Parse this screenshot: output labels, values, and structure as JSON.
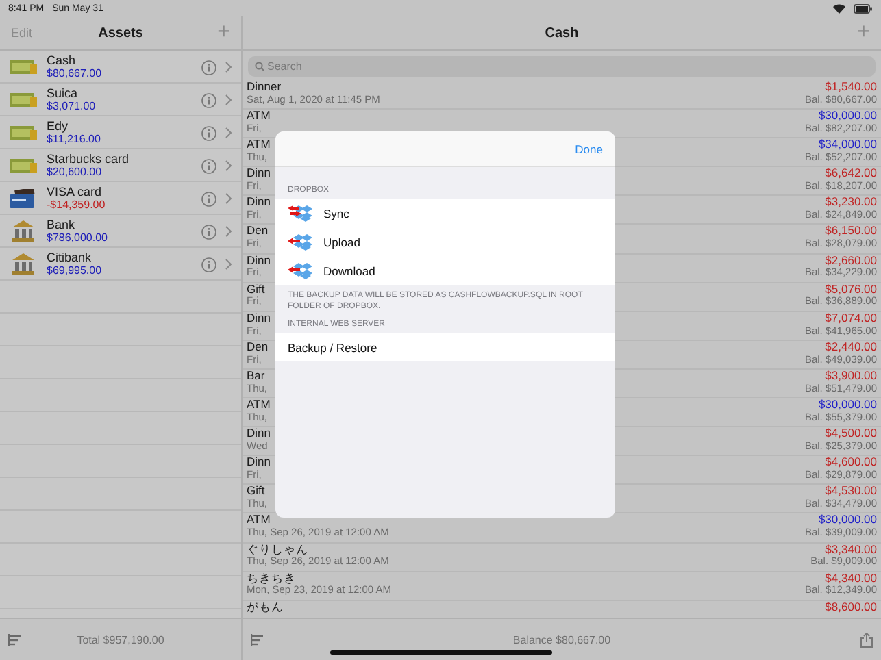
{
  "status_bar": {
    "time": "8:41 PM",
    "date": "Sun May 31"
  },
  "assets": {
    "edit": {
      "label": "Edit",
      "disabled": true
    },
    "title": "Assets",
    "add": "+",
    "items": [
      {
        "name": "Cash",
        "amount": "$80,667.00",
        "kind": "cash",
        "negative": false
      },
      {
        "name": "Suica",
        "amount": "$3,071.00",
        "kind": "cash",
        "negative": false
      },
      {
        "name": "Edy",
        "amount": "$11,216.00",
        "kind": "cash",
        "negative": false
      },
      {
        "name": "Starbucks card",
        "amount": "$20,600.00",
        "kind": "cash",
        "negative": false
      },
      {
        "name": "VISA card",
        "amount": "-$14,359.00",
        "kind": "card",
        "negative": true
      },
      {
        "name": "Bank",
        "amount": "$786,000.00",
        "kind": "bank",
        "negative": false
      },
      {
        "name": "Citibank",
        "amount": "$69,995.00",
        "kind": "bank",
        "negative": false
      }
    ],
    "total": "Total $957,190.00"
  },
  "account": {
    "title": "Cash",
    "add": "+",
    "search": {
      "placeholder": "Search"
    },
    "transactions": [
      {
        "title": "Dinner",
        "date": "Sat, Aug 1, 2020 at 11:45 PM",
        "amount": "$1,540.00",
        "kind": "expense",
        "balance": "Bal. $80,667.00"
      },
      {
        "title": "ATM",
        "date": "Fri,",
        "amount": "$30,000.00",
        "kind": "income",
        "balance": "Bal. $82,207.00"
      },
      {
        "title": "ATM",
        "date": "Thu,",
        "amount": "$34,000.00",
        "kind": "income",
        "balance": "Bal. $52,207.00"
      },
      {
        "title": "Dinn",
        "date": "Fri,",
        "amount": "$6,642.00",
        "kind": "expense",
        "balance": "Bal. $18,207.00"
      },
      {
        "title": "Dinn",
        "date": "Fri,",
        "amount": "$3,230.00",
        "kind": "expense",
        "balance": "Bal. $24,849.00"
      },
      {
        "title": "Den",
        "date": "Fri,",
        "amount": "$6,150.00",
        "kind": "expense",
        "balance": "Bal. $28,079.00"
      },
      {
        "title": "Dinn",
        "date": "Fri,",
        "amount": "$2,660.00",
        "kind": "expense",
        "balance": "Bal. $34,229.00"
      },
      {
        "title": "Gift",
        "date": "Fri,",
        "amount": "$5,076.00",
        "kind": "expense",
        "balance": "Bal. $36,889.00"
      },
      {
        "title": "Dinn",
        "date": "Fri,",
        "amount": "$7,074.00",
        "kind": "expense",
        "balance": "Bal. $41,965.00"
      },
      {
        "title": "Den",
        "date": "Fri,",
        "amount": "$2,440.00",
        "kind": "expense",
        "balance": "Bal. $49,039.00"
      },
      {
        "title": "Bar",
        "date": "Thu,",
        "amount": "$3,900.00",
        "kind": "expense",
        "balance": "Bal. $51,479.00"
      },
      {
        "title": "ATM",
        "date": "Thu,",
        "amount": "$30,000.00",
        "kind": "income",
        "balance": "Bal. $55,379.00"
      },
      {
        "title": "Dinn",
        "date": "Wed",
        "amount": "$4,500.00",
        "kind": "expense",
        "balance": "Bal. $25,379.00"
      },
      {
        "title": "Dinn",
        "date": "Fri,",
        "amount": "$4,600.00",
        "kind": "expense",
        "balance": "Bal. $29,879.00"
      },
      {
        "title": "Gift",
        "date": "Thu,",
        "amount": "$4,530.00",
        "kind": "expense",
        "balance": "Bal. $34,479.00"
      },
      {
        "title": "ATM",
        "date": "Thu, Sep 26, 2019 at 12:00 AM",
        "amount": "$30,000.00",
        "kind": "income",
        "balance": "Bal. $39,009.00"
      },
      {
        "title": "ぐりしゃん",
        "date": "Thu, Sep 26, 2019 at 12:00 AM",
        "amount": "$3,340.00",
        "kind": "expense",
        "balance": "Bal. $9,009.00"
      },
      {
        "title": "ちきちき",
        "date": "Mon, Sep 23, 2019 at 12:00 AM",
        "amount": "$4,340.00",
        "kind": "expense",
        "balance": "Bal. $12,349.00"
      },
      {
        "title": "がもん",
        "amount": "$8,600.00",
        "kind": "expense"
      }
    ],
    "balance": "Balance $80,667.00"
  },
  "dialog": {
    "done": "Done",
    "sections": [
      {
        "header": "DROPBOX",
        "rows": [
          {
            "label": "Sync",
            "kind": "sync"
          },
          {
            "label": "Upload",
            "kind": "upload"
          },
          {
            "label": "Download",
            "kind": "download"
          }
        ],
        "footer": "THE BACKUP DATA WILL BE STORED AS CASHFLOWBACKUP.SQL IN ROOT FOLDER OF DROPBOX."
      },
      {
        "header": "INTERNAL WEB SERVER",
        "rows": [
          {
            "label": "Backup / Restore",
            "kind": "plain"
          }
        ]
      }
    ]
  }
}
